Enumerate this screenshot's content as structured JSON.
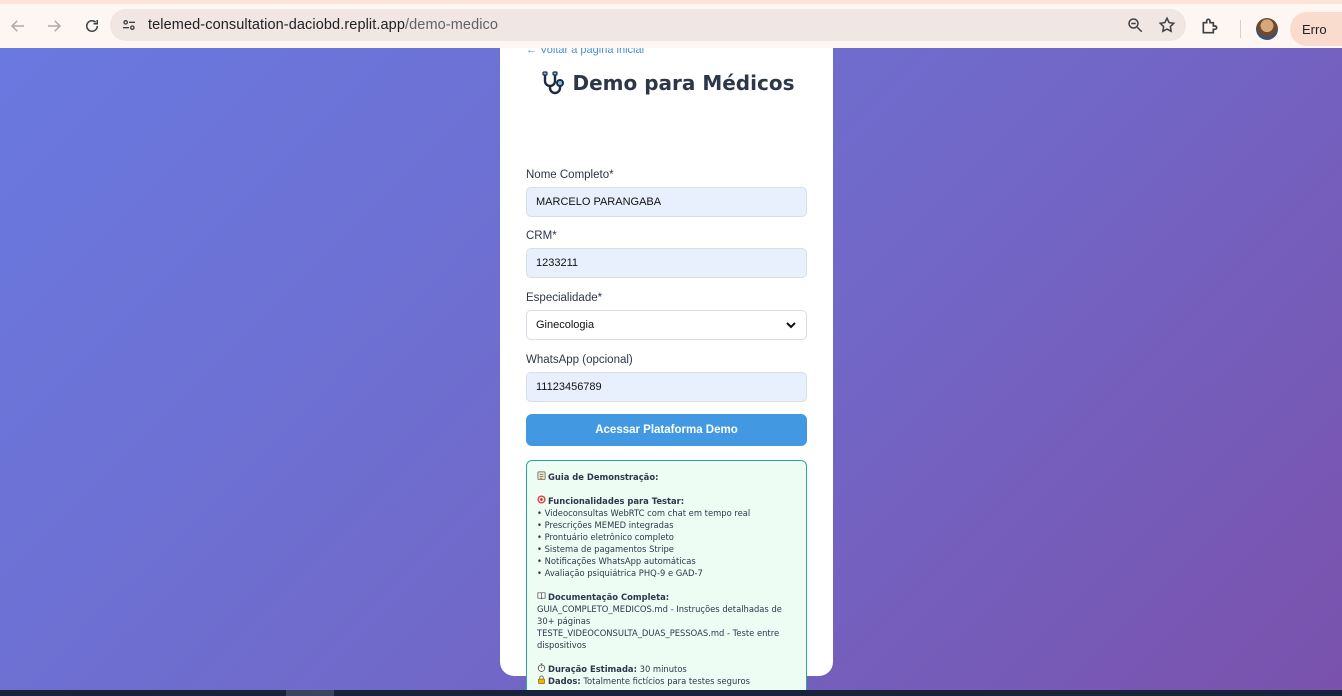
{
  "browser": {
    "url_host": "telemed-consultation-daciobd.replit.app",
    "url_path": "/demo-medico",
    "error_chip_label": "Erro",
    "menu_glyph": "⋮"
  },
  "page": {
    "back_link": "← Voltar à página inicial",
    "title": "Demo para Médicos",
    "title_icon": "stethoscope-icon",
    "fields": {
      "name_label": "Nome Completo*",
      "name_value": "MARCELO PARANGABA",
      "crm_label": "CRM*",
      "crm_value": "1233211",
      "specialty_label": "Especialidade*",
      "specialty_value": "Ginecologia",
      "whatsapp_label": "WhatsApp (opcional)",
      "whatsapp_value": "11123456789"
    },
    "submit_label": "Acessar Plataforma Demo",
    "guide": {
      "heading": "Guia de Demonstração:",
      "features_heading": "Funcionalidades para Testar:",
      "features": [
        "• Videoconsultas WebRTC com chat em tempo real",
        "• Prescrições MEMED integradas",
        "• Prontuário eletrônico completo",
        "• Sistema de pagamentos Stripe",
        "• Notificações WhatsApp automáticas",
        "• Avaliação psiquiátrica PHQ-9 e GAD-7"
      ],
      "docs_heading": "Documentação Completa:",
      "docs_lines": [
        "GUIA_COMPLETO_MEDICOS.md - Instruções detalhadas de",
        "30+ páginas",
        "TESTE_VIDEOCONSULTA_DUAS_PESSOAS.md - Teste entre",
        "dispositivos"
      ],
      "duration_label": "Duração Estimada:",
      "duration_value": "30 minutos",
      "data_label": "Dados:",
      "data_value": "Totalmente fictícios para testes seguros"
    }
  },
  "colors": {
    "accent": "#4299e1",
    "guide_border": "#2ea7a0",
    "guide_bg": "#eefdf4",
    "background_start": "#6a79e0",
    "background_end": "#7a52ad"
  }
}
